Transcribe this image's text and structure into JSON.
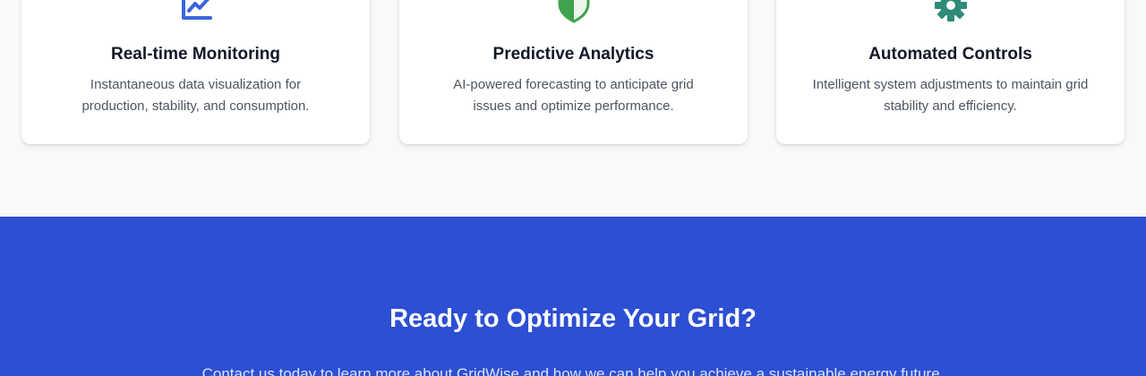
{
  "features": [
    {
      "icon": "chart-line-icon",
      "icon_color": "#3b63e0",
      "title": "Real-time Monitoring",
      "description": "Instantaneous data visualization for production, stability, and consumption."
    },
    {
      "icon": "shield-icon",
      "icon_color": "#3fa34d",
      "title": "Predictive Analytics",
      "description": "AI-powered forecasting to anticipate grid issues and optimize performance."
    },
    {
      "icon": "gear-icon",
      "icon_color": "#2f8a7a",
      "title": "Automated Controls",
      "description": "Intelligent system adjustments to maintain grid stability and efficiency."
    }
  ],
  "cta": {
    "title": "Ready to Optimize Your Grid?",
    "text": "Contact us today to learn more about GridWise and how we can help you achieve a sustainable energy future.",
    "background": "#2c4fd3"
  }
}
